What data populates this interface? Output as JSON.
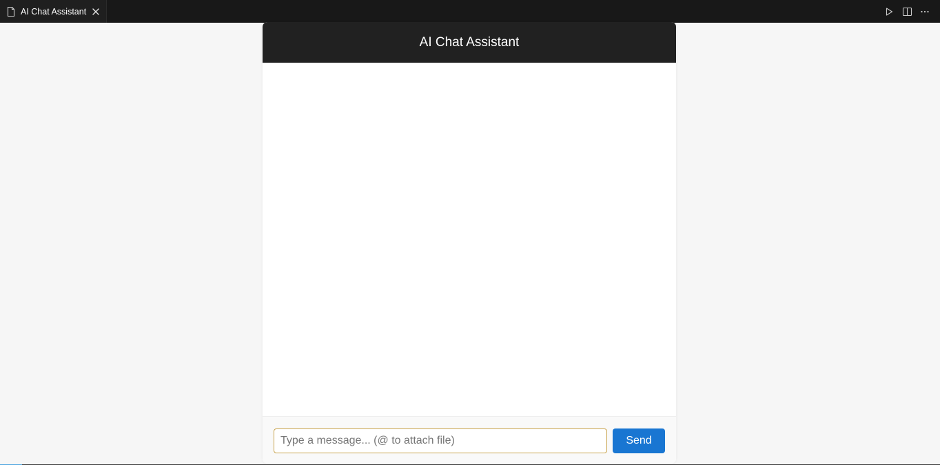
{
  "tab": {
    "label": "AI Chat Assistant",
    "icon": "file-icon",
    "close_icon": "close-icon"
  },
  "title_actions": [
    "run-icon",
    "split-editor-icon",
    "more-actions-icon"
  ],
  "chat": {
    "header_title": "AI Chat Assistant",
    "input_placeholder": "Type a message... (@ to attach file)",
    "input_value": "",
    "send_label": "Send"
  },
  "colors": {
    "header_bg": "#212121",
    "send_button": "#1976d2",
    "input_border_focus": "#c8a24a",
    "titlebar_bg": "#181818"
  }
}
